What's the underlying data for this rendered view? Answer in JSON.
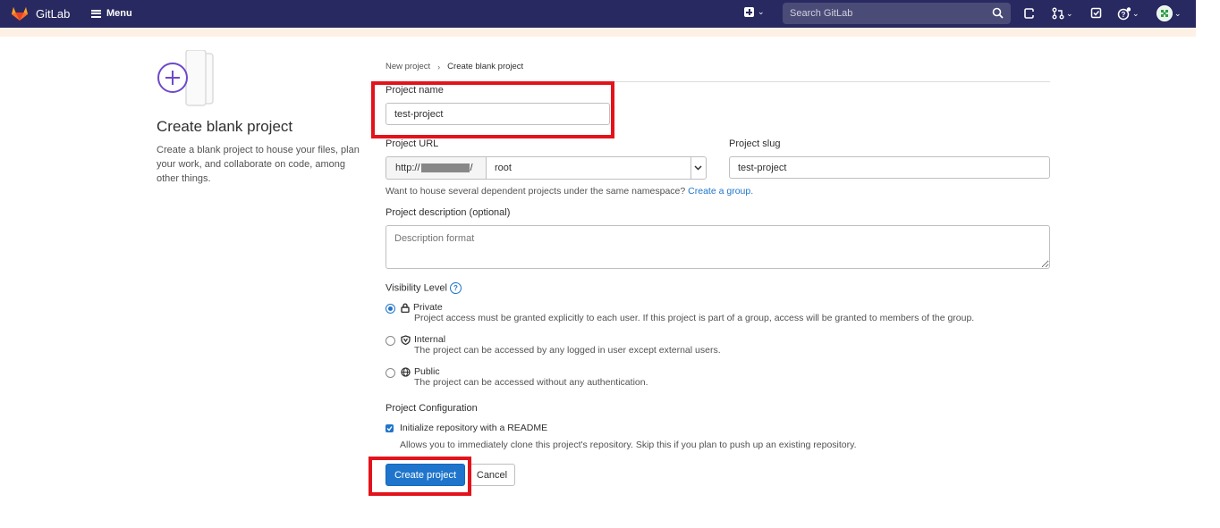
{
  "nav": {
    "brand": "GitLab",
    "menu_label": "Menu",
    "search_placeholder": "Search GitLab"
  },
  "sidebar": {
    "title": "Create blank project",
    "description": "Create a blank project to house your files, plan your work, and collaborate on code, among other things."
  },
  "breadcrumb": {
    "parent": "New project",
    "current": "Create blank project"
  },
  "form": {
    "project_name_label": "Project name",
    "project_name_value": "test-project",
    "project_url_label": "Project URL",
    "url_prefix_start": "http://",
    "url_prefix_end": "/",
    "namespace_value": "root",
    "project_slug_label": "Project slug",
    "project_slug_value": "test-project",
    "namespace_help": "Want to house several dependent projects under the same namespace?",
    "create_group_link": "Create a group.",
    "description_label": "Project description (optional)",
    "description_placeholder": "Description format",
    "visibility_label": "Visibility Level",
    "visibility_options": [
      {
        "label": "Private",
        "desc": "Project access must be granted explicitly to each user. If this project is part of a group, access will be granted to members of the group.",
        "selected": true
      },
      {
        "label": "Internal",
        "desc": "The project can be accessed by any logged in user except external users.",
        "selected": false
      },
      {
        "label": "Public",
        "desc": "The project can be accessed without any authentication.",
        "selected": false
      }
    ],
    "config_label": "Project Configuration",
    "readme_label": "Initialize repository with a README",
    "readme_checked": true,
    "readme_desc": "Allows you to immediately clone this project's repository. Skip this if you plan to push up an existing repository.",
    "create_button": "Create project",
    "cancel_button": "Cancel"
  },
  "colors": {
    "nav_bg": "#292961",
    "primary": "#1f75cb",
    "highlight": "#e3131b"
  }
}
